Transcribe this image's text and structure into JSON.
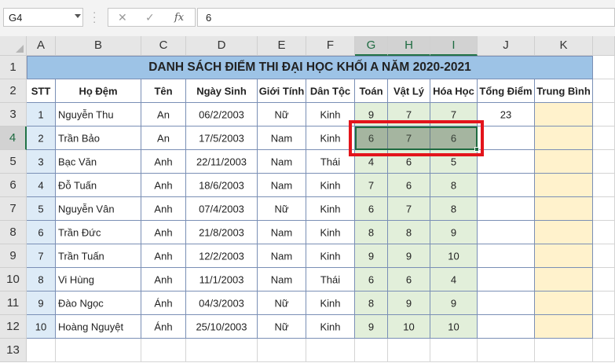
{
  "formula_bar": {
    "name_box": "G4",
    "formula": "6",
    "icons": {
      "cancel": "close-icon",
      "enter": "checkmark-icon",
      "insert_function": "function-icon"
    },
    "cancel_glyph": "✕",
    "enter_glyph": "✓",
    "fx_glyph": "fx"
  },
  "sheet": {
    "columns": [
      "A",
      "B",
      "C",
      "D",
      "E",
      "F",
      "G",
      "H",
      "I",
      "J",
      "K"
    ],
    "rows": [
      "1",
      "2",
      "3",
      "4",
      "5",
      "6",
      "7",
      "8",
      "9",
      "10",
      "11",
      "12",
      "13"
    ],
    "selected_range": "G4:I4",
    "active_cell": "G4"
  },
  "table": {
    "title": "DANH SÁCH ĐIỂM THI ĐẠI HỌC KHỐI A NĂM 2020-2021",
    "headers": [
      "STT",
      "Họ Đệm",
      "Tên",
      "Ngày Sinh",
      "Giới Tính",
      "Dân Tộc",
      "Toán",
      "Vật Lý",
      "Hóa Học",
      "Tổng Điểm",
      "Trung Bình"
    ],
    "rows": [
      [
        "1",
        "Nguyễn Thu",
        "An",
        "06/2/2003",
        "Nữ",
        "Kinh",
        "9",
        "7",
        "7",
        "23",
        ""
      ],
      [
        "2",
        "Trần Bảo",
        "An",
        "17/5/2003",
        "Nam",
        "Kinh",
        "6",
        "7",
        "6",
        "",
        ""
      ],
      [
        "3",
        "Bạc Văn",
        "Anh",
        "22/11/2003",
        "Nam",
        "Thái",
        "4",
        "6",
        "5",
        "",
        ""
      ],
      [
        "4",
        "Đỗ Tuấn",
        "Anh",
        "18/6/2003",
        "Nam",
        "Kinh",
        "7",
        "6",
        "8",
        "",
        ""
      ],
      [
        "5",
        "Nguyễn Vân",
        "Anh",
        "07/4/2003",
        "Nữ",
        "Kinh",
        "6",
        "7",
        "8",
        "",
        ""
      ],
      [
        "6",
        "Trần Đức",
        "Anh",
        "21/8/2003",
        "Nam",
        "Kinh",
        "8",
        "8",
        "9",
        "",
        ""
      ],
      [
        "7",
        "Trần Tuấn",
        "Anh",
        "12/2/2003",
        "Nam",
        "Kinh",
        "9",
        "9",
        "10",
        "",
        ""
      ],
      [
        "8",
        "Vi Hùng",
        "Anh",
        "11/1/2003",
        "Nam",
        "Thái",
        "6",
        "6",
        "4",
        "",
        ""
      ],
      [
        "9",
        "Đào Ngọc",
        "Ánh",
        "04/3/2003",
        "Nữ",
        "Kinh",
        "8",
        "9",
        "9",
        "",
        ""
      ],
      [
        "10",
        "Hoàng Nguyệt",
        "Ánh",
        "25/10/2003",
        "Nữ",
        "Kinh",
        "9",
        "10",
        "10",
        "",
        ""
      ]
    ]
  },
  "colors": {
    "title_fill": "#9dc3e6",
    "score_fill": "#e2efda",
    "average_fill": "#fff2cc",
    "stt_fill": "#ddebf7",
    "selection": "#217346",
    "highlight_box": "#e3141b"
  }
}
